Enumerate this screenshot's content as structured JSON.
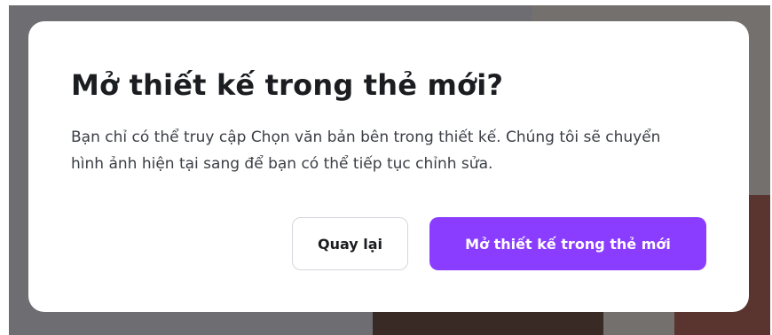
{
  "dialog": {
    "title": "Mở thiết kế trong thẻ mới?",
    "body": "Bạn chỉ có thể truy cập Chọn văn bản bên trong thiết kế. Chúng tôi sẽ chuyển hình ảnh hiện tại sang để bạn có thể tiếp tục chỉnh sửa.",
    "back_label": "Quay lại",
    "open_label": "Mở thiết kế trong thẻ mới"
  },
  "colors": {
    "primary": "#8b3dff",
    "overlay": "#6e6e72",
    "text": "#1b1d21"
  }
}
